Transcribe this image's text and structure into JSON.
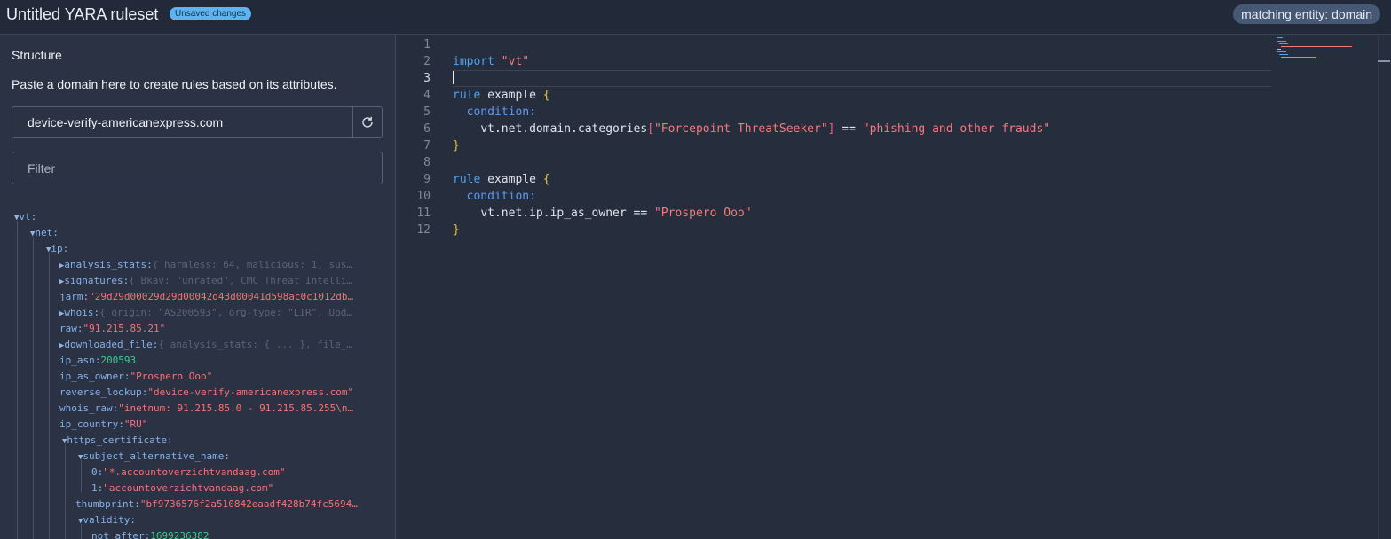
{
  "header": {
    "title": "Untitled YARA ruleset",
    "badge": "Unsaved changes",
    "entity": "matching entity: domain"
  },
  "sidebar": {
    "title": "Structure",
    "help": "Paste a domain here to create rules based on its attributes.",
    "domain_value": "device-verify-americanexpress.com",
    "refresh_icon": "refresh-icon",
    "filter_placeholder": "Filter",
    "tree": [
      {
        "caret": "▼",
        "key": "vt:",
        "value": "",
        "kind": "node"
      },
      {
        "caret": "▼",
        "key": "net:",
        "value": "",
        "kind": "node"
      },
      {
        "caret": "▼",
        "key": "ip:",
        "value": "",
        "kind": "node"
      },
      {
        "caret": "▶",
        "key": "analysis_stats:",
        "value": "{ harmless: 64, malicious: 1, sus…",
        "kind": "dim"
      },
      {
        "caret": "▶",
        "key": "signatures:",
        "value": "{ Bkav: \"unrated\", CMC Threat Intelli…",
        "kind": "dim"
      },
      {
        "caret": "",
        "key": "jarm:",
        "value": "\"29d29d00029d29d00042d43d00041d598ac0c1012db…",
        "kind": "str"
      },
      {
        "caret": "▶",
        "key": "whois:",
        "value": "{ origin: \"AS200593\", org-type: \"LIR\", Upd…",
        "kind": "dim"
      },
      {
        "caret": "",
        "key": "raw:",
        "value": "\"91.215.85.21\"",
        "kind": "str"
      },
      {
        "caret": "▶",
        "key": "downloaded_file:",
        "value": "{ analysis_stats: { ... }, file_…",
        "kind": "dim"
      },
      {
        "caret": "",
        "key": "ip_asn:",
        "value": "200593",
        "kind": "num"
      },
      {
        "caret": "",
        "key": "ip_as_owner:",
        "value": "\"Prospero Ooo\"",
        "kind": "str"
      },
      {
        "caret": "",
        "key": "reverse_lookup:",
        "value": "\"device-verify-americanexpress.com\"",
        "kind": "str"
      },
      {
        "caret": "",
        "key": "whois_raw:",
        "value": "\"inetnum: 91.215.85.0 - 91.215.85.255\\n…",
        "kind": "str"
      },
      {
        "caret": "",
        "key": "ip_country:",
        "value": "\"RU\"",
        "kind": "str"
      },
      {
        "caret": "▼",
        "key": "https_certificate:",
        "value": "",
        "kind": "node"
      },
      {
        "caret": "▼",
        "key": "subject_alternative_name:",
        "value": "",
        "kind": "node"
      },
      {
        "caret": "",
        "key": "0:",
        "value": "\"*.accountoverzichtvandaag.com\"",
        "kind": "str"
      },
      {
        "caret": "",
        "key": "1:",
        "value": "\"accountoverzichtvandaag.com\"",
        "kind": "str"
      },
      {
        "caret": "",
        "key": "thumbprint:",
        "value": "\"bf9736576f2a510842eaadf428b74fc5694…",
        "kind": "str"
      },
      {
        "caret": "▼",
        "key": "validity:",
        "value": "",
        "kind": "node"
      },
      {
        "caret": "",
        "key": "not_after:",
        "value": "1699236382",
        "kind": "num"
      }
    ]
  },
  "editor": {
    "line_numbers": [
      "1",
      "2",
      "3",
      "4",
      "5",
      "6",
      "7",
      "8",
      "9",
      "10",
      "11",
      "12"
    ],
    "code": {
      "l2_kw": "import",
      "l2_str": "\"vt\"",
      "l4_kw": "rule",
      "l4_name": " example ",
      "l4_brace": "{",
      "l5_kw": "condition:",
      "l6_expr": "vt.net.domain.categories",
      "l6_open": "[",
      "l6_key": "\"Forcepoint ThreatSeeker\"",
      "l6_close": "]",
      "l6_op": " == ",
      "l6_val": "\"phishing and other frauds\"",
      "l7_brace": "}",
      "l9_kw": "rule",
      "l9_name": " example ",
      "l9_brace": "{",
      "l10_kw": "condition:",
      "l11_expr": "vt.net.ip.ip_as_owner == ",
      "l11_val": "\"Prospero Ooo\"",
      "l12_brace": "}"
    }
  },
  "colors": {
    "background": "#262d3d",
    "sidebar": "#2a3243",
    "badge": "#5fb3f0",
    "entity_pill": "#465874",
    "keyword": "#4ea2f3",
    "string": "#f47a7a",
    "number": "#3dcb92",
    "brace": "#e7c23c"
  }
}
